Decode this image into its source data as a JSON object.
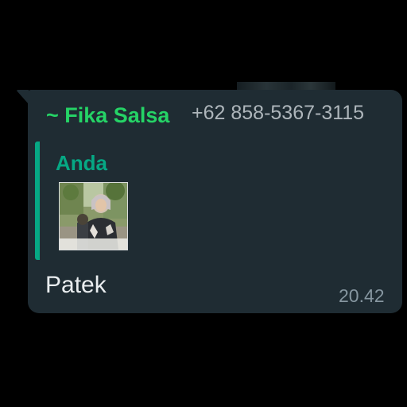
{
  "message": {
    "sender_name": "~ Fika Salsa",
    "sender_phone": "+62 858-5367-3115",
    "quoted": {
      "author": "Anda",
      "media": "photo-thumbnail"
    },
    "text": "Patek",
    "time": "20.42"
  },
  "colors": {
    "background": "#000000",
    "bubble": "#1f2c33",
    "sender_name": "#25d366",
    "quote_accent": "#06a884",
    "text": "#e9edef",
    "meta": "#8696a0"
  }
}
